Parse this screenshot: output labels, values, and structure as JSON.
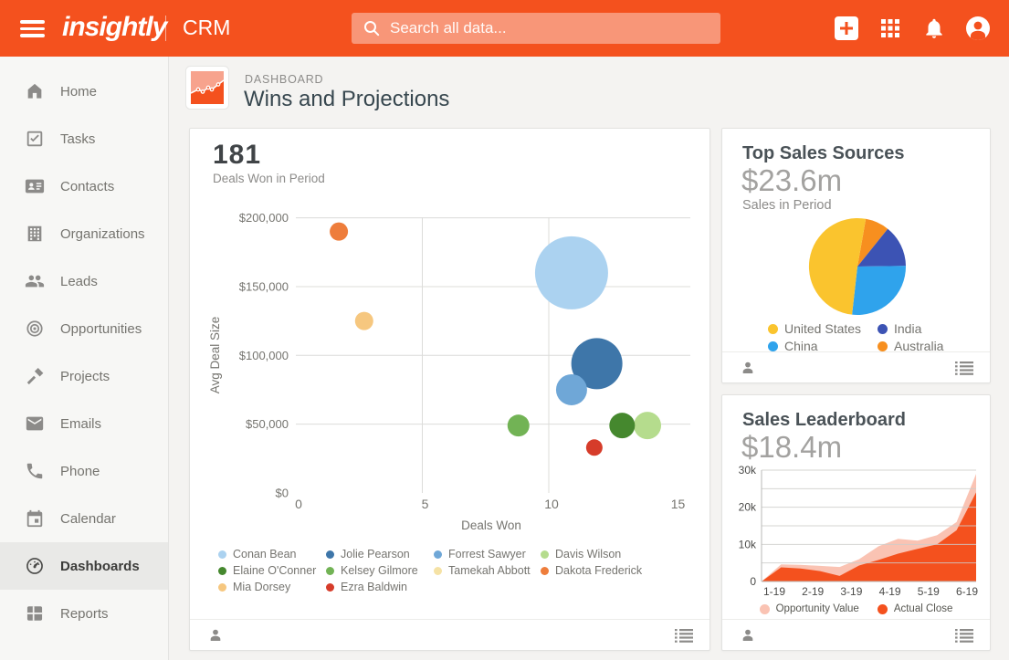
{
  "topbar": {
    "logo_text": "insightly",
    "product_label": "CRM",
    "search_placeholder": "Search all data...",
    "accent_color": "#F4511E"
  },
  "sidebar": {
    "items": [
      {
        "label": "Home",
        "icon": "home",
        "selected": false
      },
      {
        "label": "Tasks",
        "icon": "tasks",
        "selected": false
      },
      {
        "label": "Contacts",
        "icon": "contacts",
        "selected": false
      },
      {
        "label": "Organizations",
        "icon": "organizations",
        "selected": false
      },
      {
        "label": "Leads",
        "icon": "leads",
        "selected": false
      },
      {
        "label": "Opportunities",
        "icon": "opportunities",
        "selected": false
      },
      {
        "label": "Projects",
        "icon": "projects",
        "selected": false
      },
      {
        "label": "Emails",
        "icon": "emails",
        "selected": false
      },
      {
        "label": "Phone",
        "icon": "phone",
        "selected": false
      },
      {
        "label": "Calendar",
        "icon": "calendar",
        "selected": false
      },
      {
        "label": "Dashboards",
        "icon": "dashboards",
        "selected": true
      },
      {
        "label": "Reports",
        "icon": "reports",
        "selected": false
      }
    ]
  },
  "header": {
    "eyebrow": "DASHBOARD",
    "title": "Wins and Projections"
  },
  "wins_card": {
    "metric": "181",
    "metric_label": "Deals Won in Period"
  },
  "sources_card": {
    "title": "Top Sales Sources",
    "metric": "$23.6m",
    "metric_label": "Sales in Period"
  },
  "leaderboard_card": {
    "title": "Sales Leaderboard",
    "metric": "$18.4m"
  },
  "chart_data": [
    {
      "type": "scatter",
      "title": "Deals Won in Period",
      "xlabel": "Deals Won",
      "ylabel": "Avg Deal Size",
      "xlim": [
        0,
        16
      ],
      "ylim": [
        0,
        210000
      ],
      "xticks": [
        0,
        5,
        10,
        15
      ],
      "yticks": [
        {
          "v": 0,
          "label": "$0"
        },
        {
          "v": 50000,
          "label": "$50,000"
        },
        {
          "v": 100000,
          "label": "$100,000"
        },
        {
          "v": 150000,
          "label": "$150,000"
        },
        {
          "v": 200000,
          "label": "$200,000"
        }
      ],
      "grid_x": [
        5,
        10
      ],
      "grid_y": [
        50000,
        100000,
        150000,
        200000
      ],
      "legend": [
        {
          "name": "Conan Bean",
          "color": "#ABD2F0"
        },
        {
          "name": "Jolie Pearson",
          "color": "#3E76A9"
        },
        {
          "name": "Forrest Sawyer",
          "color": "#6FA7D7"
        },
        {
          "name": "Davis Wilson",
          "color": "#B5DC8D"
        },
        {
          "name": "Elaine O'Conner",
          "color": "#45882E"
        },
        {
          "name": "Kelsey Gilmore",
          "color": "#72B355"
        },
        {
          "name": "Tamekah Abbott",
          "color": "#F5E2A5"
        },
        {
          "name": "Dakota Frederick",
          "color": "#EE7D3B"
        },
        {
          "name": "Mia Dorsey",
          "color": "#F6C77F"
        },
        {
          "name": "Ezra Baldwin",
          "color": "#D63C2A"
        }
      ],
      "bubbles": [
        {
          "name": "Conan Bean",
          "x": 10.9,
          "y": 160000,
          "r": 40
        },
        {
          "name": "Jolie Pearson",
          "x": 11.9,
          "y": 94000,
          "r": 28
        },
        {
          "name": "Forrest Sawyer",
          "x": 10.9,
          "y": 75000,
          "r": 17
        },
        {
          "name": "Davis Wilson",
          "x": 13.9,
          "y": 49000,
          "r": 15
        },
        {
          "name": "Elaine O'Conner",
          "x": 12.9,
          "y": 49000,
          "r": 14
        },
        {
          "name": "Kelsey Gilmore",
          "x": 8.8,
          "y": 49000,
          "r": 12
        },
        {
          "name": "Dakota Frederick",
          "x": 1.7,
          "y": 190000,
          "r": 10
        },
        {
          "name": "Mia Dorsey",
          "x": 2.7,
          "y": 125000,
          "r": 10
        },
        {
          "name": "Ezra Baldwin",
          "x": 11.8,
          "y": 33000,
          "r": 9
        }
      ]
    },
    {
      "type": "pie",
      "title": "Top Sales Sources",
      "total_label": "$23.6m",
      "subtitle": "Sales in Period",
      "start_angle_deg": 10,
      "draw_order": [
        "Australia",
        "India",
        "China",
        "United States"
      ],
      "slices": [
        {
          "label": "United States",
          "color": "#FAC42E",
          "pct": 51
        },
        {
          "label": "India",
          "color": "#3C53B4",
          "pct": 14
        },
        {
          "label": "China",
          "color": "#2FA3EC",
          "pct": 27
        },
        {
          "label": "Australia",
          "color": "#F78F1F",
          "pct": 8
        }
      ],
      "legend_order": [
        "United States",
        "India",
        "China",
        "Australia"
      ]
    },
    {
      "type": "area",
      "title": "Sales Leaderboard",
      "total_label": "$18.4m",
      "unit": "thousands",
      "ylim": [
        0,
        30
      ],
      "grid_step": 5,
      "yticks": [
        {
          "v": 0,
          "label": "0"
        },
        {
          "v": 10,
          "label": "10k"
        },
        {
          "v": 20,
          "label": "20k"
        },
        {
          "v": 30,
          "label": "30k"
        }
      ],
      "xticks": [
        "1-19",
        "2-19",
        "3-19",
        "4-19",
        "5-19",
        "6-19"
      ],
      "series": [
        {
          "name": "Opportunity Value",
          "color": "#FAC3B3",
          "values": [
            0,
            4.6,
            4.5,
            4.2,
            3.9,
            6,
            9.5,
            11.5,
            11,
            12.5,
            16,
            29
          ]
        },
        {
          "name": "Actual Close",
          "color": "#F4511E",
          "values": [
            0,
            3.8,
            3.5,
            2.8,
            1.5,
            4.3,
            5.8,
            7.5,
            8.8,
            10,
            13.8,
            24
          ]
        }
      ]
    }
  ]
}
